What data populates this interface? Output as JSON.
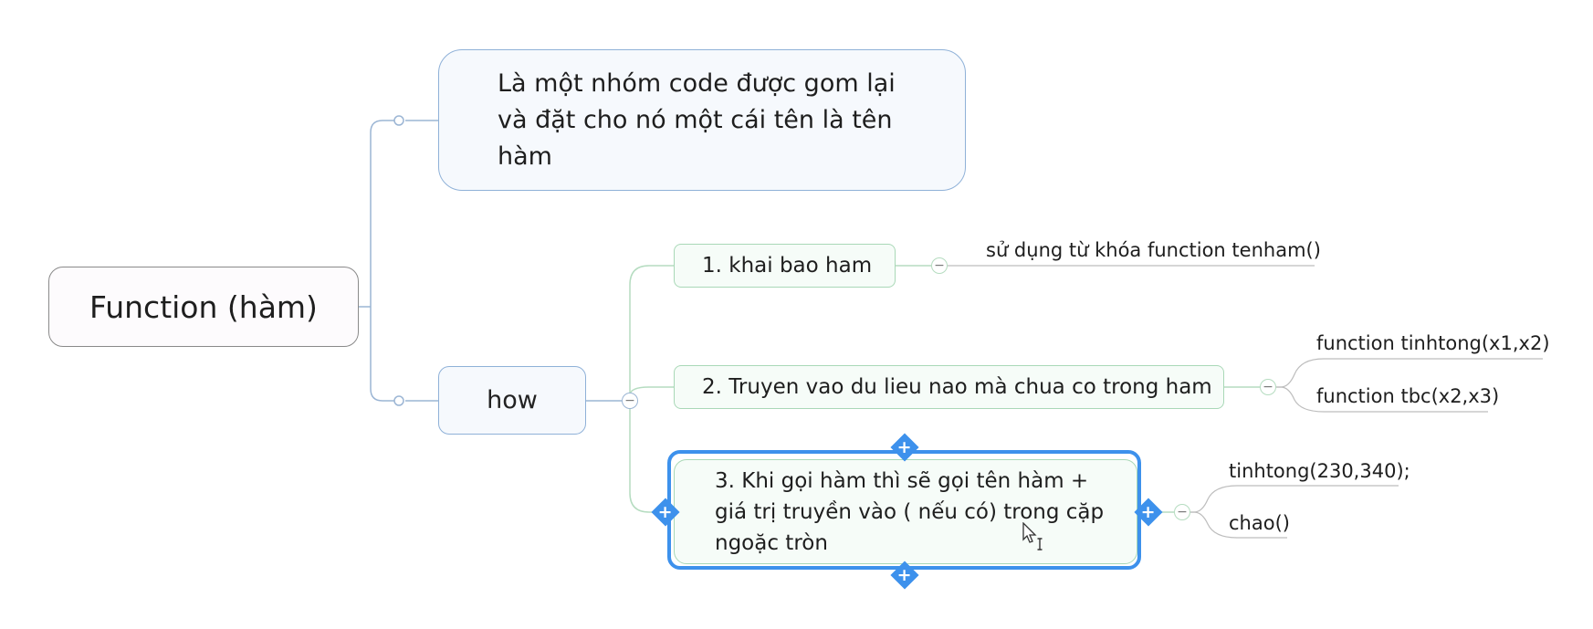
{
  "mindmap": {
    "root": {
      "label": "Function (hàm)"
    },
    "definition": {
      "label": "Là một nhóm code được gom lại và đặt cho nó một cái tên là tên hàm"
    },
    "how": {
      "label": "how",
      "steps": [
        {
          "label": "1. khai bao ham",
          "details": [
            "sử dụng từ khóa function tenham()"
          ]
        },
        {
          "label": "2. Truyen vao du lieu nao mà chua co trong ham",
          "details": [
            "function tinhtong(x1,x2)",
            "function tbc(x2,x3)"
          ]
        },
        {
          "label": "3. Khi gọi hàm thì sẽ gọi tên hàm + giá trị truyền vào ( nếu có) trong cặp ngoặc tròn",
          "details": [
            "tinhtong(230,340);",
            "chao()"
          ]
        }
      ]
    },
    "selected_node": "3. Khi gọi hàm thì sẽ gọi tên hàm + giá trị truyền vào ( nếu có) trong cặp ngoặc tròn",
    "colors": {
      "root_border": "#8a8a8a",
      "main_topic_border": "#8fb1d8",
      "step_border": "#a9d8b7",
      "selection": "#3d91ec",
      "line_blue": "#9bb5d4",
      "line_green": "#b5dcc0",
      "line_gray": "#9a9a9a"
    },
    "icons": [
      "collapse-icon",
      "add-topic-icon",
      "mouse-cursor-icon"
    ]
  }
}
